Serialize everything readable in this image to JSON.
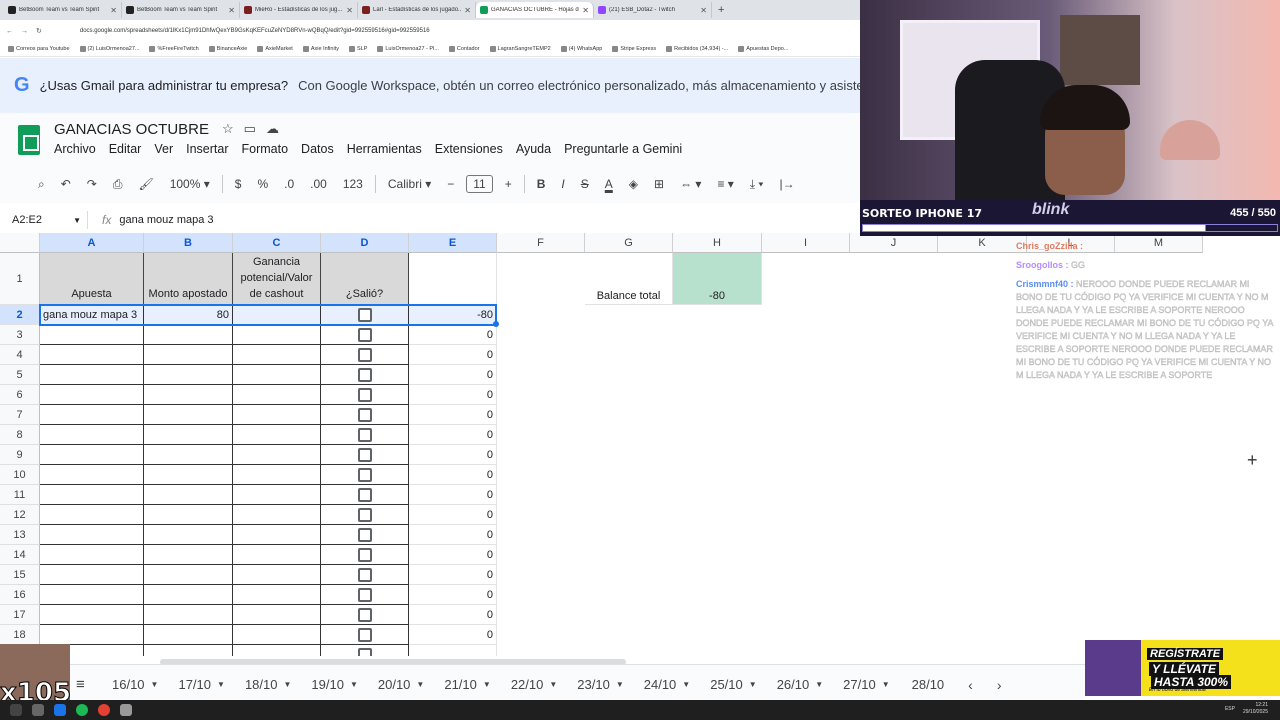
{
  "browser": {
    "tabs": [
      {
        "title": "BetBoom Team vs Team Spirit",
        "color": "#222222"
      },
      {
        "title": "BetBoom Team vs Team Spirit",
        "color": "#222222"
      },
      {
        "title": "MieRo - Estadísticas de los jug...",
        "color": "#7b1f1f"
      },
      {
        "title": "Larl - Estadísticas de los jugado...",
        "color": "#7b1f1f"
      },
      {
        "title": "GANACIAS OCTUBRE - Hojas de...",
        "color": "#0f9d58",
        "active": true
      },
      {
        "title": "(21) ESB_Dota2 - Twitch",
        "color": "#9146ff"
      }
    ],
    "new_tab": "+",
    "url": "docs.google.com/spreadsheets/d/1lKx1Cjm91DhfwQexYB9GsKqKEFcuZeNYD8RVn-wQBqQ/edit?gid=992559516#gid=992559516",
    "bookmarks": [
      "Correos para Youtube",
      "(2) LuisOrmenoa27...",
      "%FreeFireTwitch",
      "BinanceAxie",
      "AxieMarket",
      "Axie Infinity",
      "SLP",
      "LuisOrmenoa27 - Pl...",
      "Contador",
      "LagranSangreTEMP2",
      "(4) WhatsApp",
      "Stripe Express",
      "Recibidos (34,934) -...",
      "Apuestas Depo..."
    ]
  },
  "promo": {
    "logo": "G",
    "headline": "¿Usas Gmail para administrar tu empresa?",
    "body": "Con Google Workspace, obtén un correo electrónico personalizado, más almacenamiento y asistencia"
  },
  "doc": {
    "title": "GANACIAS OCTUBRE",
    "menu": [
      "Archivo",
      "Editar",
      "Ver",
      "Insertar",
      "Formato",
      "Datos",
      "Herramientas",
      "Extensiones",
      "Ayuda",
      "Preguntarle a Gemini"
    ]
  },
  "toolbar": {
    "zoom": "100%",
    "currency": "$",
    "percent": "%",
    "dec_less": ".0",
    "dec_more": ".00",
    "format_123": "123",
    "font": "Calibri",
    "font_size": "11",
    "bold": "B",
    "italic": "I",
    "strike": "S",
    "text_color": "A"
  },
  "formula_bar": {
    "name_box": "A2:E2",
    "fx": "fx",
    "content": "gana mouz mapa 3"
  },
  "grid": {
    "columns": [
      "A",
      "B",
      "C",
      "D",
      "E",
      "F",
      "G",
      "H",
      "I",
      "J",
      "K",
      "L",
      "M"
    ],
    "rows": [
      "1",
      "2",
      "3",
      "4",
      "5",
      "6",
      "7",
      "8",
      "9",
      "10",
      "11",
      "12",
      "13",
      "14",
      "15",
      "16",
      "17",
      "18"
    ],
    "headers": {
      "a": "Apuesta",
      "b": "Monto apostado",
      "c": "Ganancia potencial/Valor de cashout",
      "d": "¿Salió?"
    },
    "balance_label": "Balance total",
    "balance_value": "-80",
    "row2": {
      "a": "gana mouz mapa 3",
      "b": "80",
      "e": "-80"
    },
    "e_values": [
      "0",
      "0",
      "0",
      "0",
      "0",
      "0",
      "0",
      "0",
      "0",
      "0",
      "0",
      "0",
      "0",
      "0",
      "0",
      "0"
    ]
  },
  "sheet_tabs": [
    "16/10",
    "17/10",
    "18/10",
    "19/10",
    "20/10",
    "21/10",
    "22/10",
    "23/10",
    "24/10",
    "25/10",
    "26/10",
    "27/10",
    "28/10"
  ],
  "stream": {
    "giveaway": "SORTEO IPHONE 17",
    "count": "455 / 550",
    "progress": 0.827,
    "brand": "blink",
    "chat": [
      {
        "user": "Chris_goZzilla :",
        "text": ""
      },
      {
        "user": "Sroogollos :",
        "text": "GG"
      },
      {
        "user": "Crismmnf40 :",
        "text": "NEROOO DONDE PUEDE RECLAMAR MI BONO DE TU CÓDIGO PQ YA VERIFICE MI CUENTA Y NO M LLEGA NADA Y YA LE ESCRIBE A SOPORTE NEROOO DONDE PUEDE RECLAMAR MI BONO DE TU CÓDIGO PQ YA VERIFICE MI CUENTA Y NO M LLEGA NADA Y YA LE ESCRIBE A SOPORTE NEROOO DONDE PUEDE RECLAMAR MI BONO DE TU CÓDIGO PQ YA VERIFICE MI CUENTA Y NO M LLEGA NADA Y YA LE ESCRIBE A SOPORTE"
      }
    ],
    "multiplier": "x105",
    "ad": {
      "line1": "REGÍSTRATE",
      "line2": "Y LLÉVATE",
      "line3": "HASTA 300%",
      "line4": "En tu bono de bienvenida"
    }
  },
  "taskbar": {
    "lang": "ESP",
    "time": "12:21",
    "date": "29/10/2025"
  }
}
